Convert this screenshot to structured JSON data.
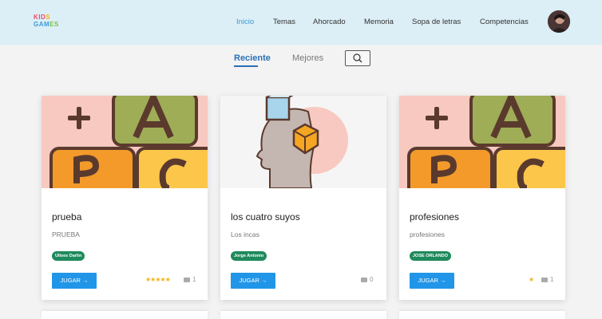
{
  "header": {
    "logo_line1_a": "KID",
    "logo_line1_b": "S",
    "logo_line2_a": "GAM",
    "logo_line2_b": "ES",
    "nav": [
      {
        "label": "Inicio",
        "active": true
      },
      {
        "label": "Temas"
      },
      {
        "label": "Ahorcado"
      },
      {
        "label": "Memoria"
      },
      {
        "label": "Sopa de letras"
      },
      {
        "label": "Competencias"
      }
    ]
  },
  "tabs": {
    "recent": "Reciente",
    "best": "Mejores"
  },
  "cards": [
    {
      "title": "prueba",
      "subtitle": "PRUEBA",
      "author": "Ulises Darlin",
      "play": "JUGAR →",
      "stars": "★★★★★",
      "comments": "1",
      "image": "abc-blocks"
    },
    {
      "title": "los cuatro suyos",
      "subtitle": "Los incas",
      "author": "Jorge Antonio",
      "play": "JUGAR →",
      "stars": "",
      "comments": "0",
      "image": "head-cubes"
    },
    {
      "title": "profesiones",
      "subtitle": "profesiones",
      "author": "JOSE ORLANDO",
      "play": "JUGAR →",
      "stars": "★",
      "comments": "1",
      "image": "abc-blocks"
    }
  ],
  "colors": {
    "header_bg": "#dceef6",
    "accent": "#3a9ad9",
    "button": "#2196e8",
    "badge": "#1f8a5c",
    "star": "#f3b317"
  }
}
